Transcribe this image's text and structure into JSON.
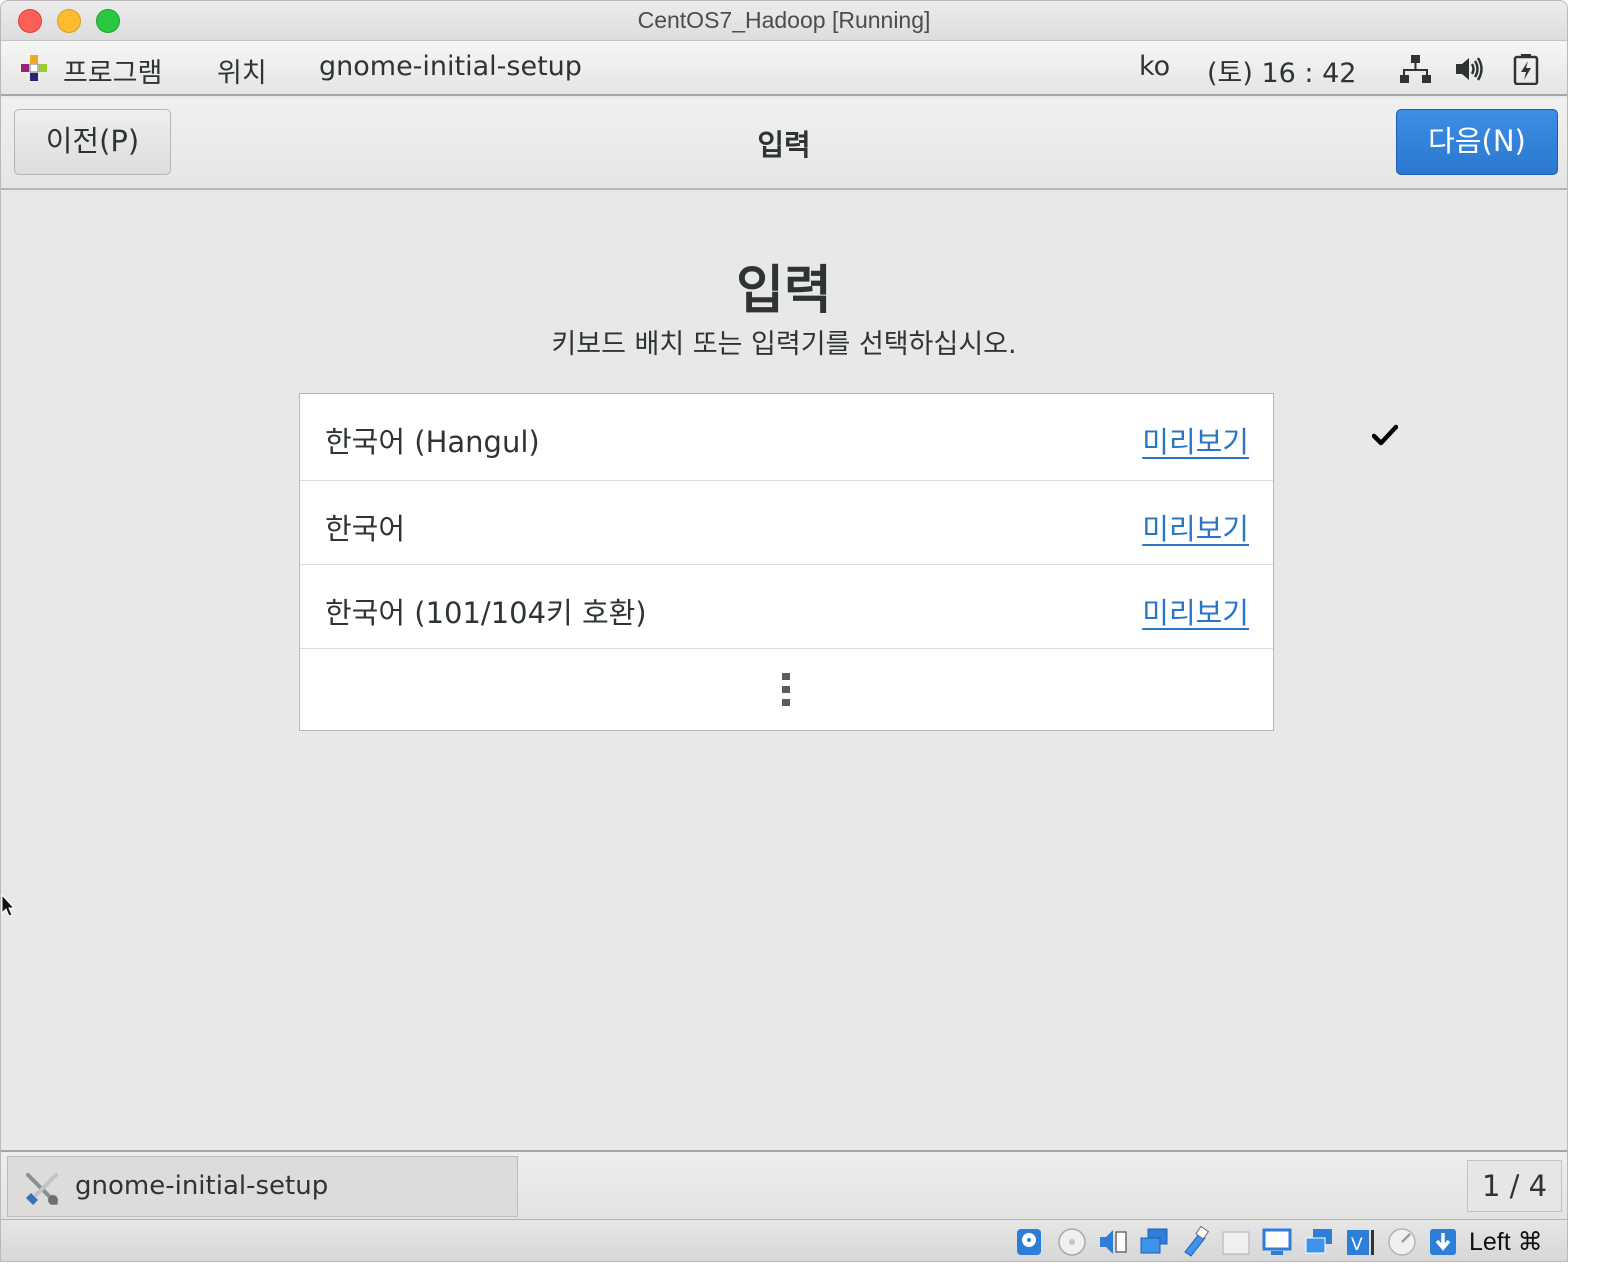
{
  "window": {
    "title": "CentOS7_Hadoop [Running]"
  },
  "topbar": {
    "programs": "프로그램",
    "places": "위치",
    "app_name": "gnome-initial-setup",
    "language": "ko",
    "clock": "(토) 16 : 42"
  },
  "header": {
    "prev_label": "이전(P)",
    "title": "입력",
    "next_label": "다음(N)"
  },
  "page": {
    "heading": "입력",
    "subtitle": "키보드 배치 또는 입력기를 선택하십시오."
  },
  "input_sources": [
    {
      "label": "한국어 (Hangul)",
      "selected": true,
      "preview": "미리보기"
    },
    {
      "label": "한국어",
      "selected": false,
      "preview": "미리보기"
    },
    {
      "label": "한국어 (101/104키 호환)",
      "selected": false,
      "preview": "미리보기"
    }
  ],
  "taskbar": {
    "task_label": "gnome-initial-setup",
    "workspace": "1 / 4"
  },
  "vbox_status": {
    "host_key": "Left ⌘",
    "icons": [
      "hard-disk-icon",
      "optical-drive-icon",
      "audio-icon",
      "network-icon",
      "usb-icon",
      "shared-folders-icon",
      "display-icon",
      "video-capture-icon",
      "virtualization-icon",
      "mouse-integration-icon",
      "keyboard-capture-icon"
    ]
  },
  "colors": {
    "accent": "#2a78d1",
    "link": "#2a76c6",
    "background": "#e8e8e7",
    "text": "#2e3436"
  }
}
